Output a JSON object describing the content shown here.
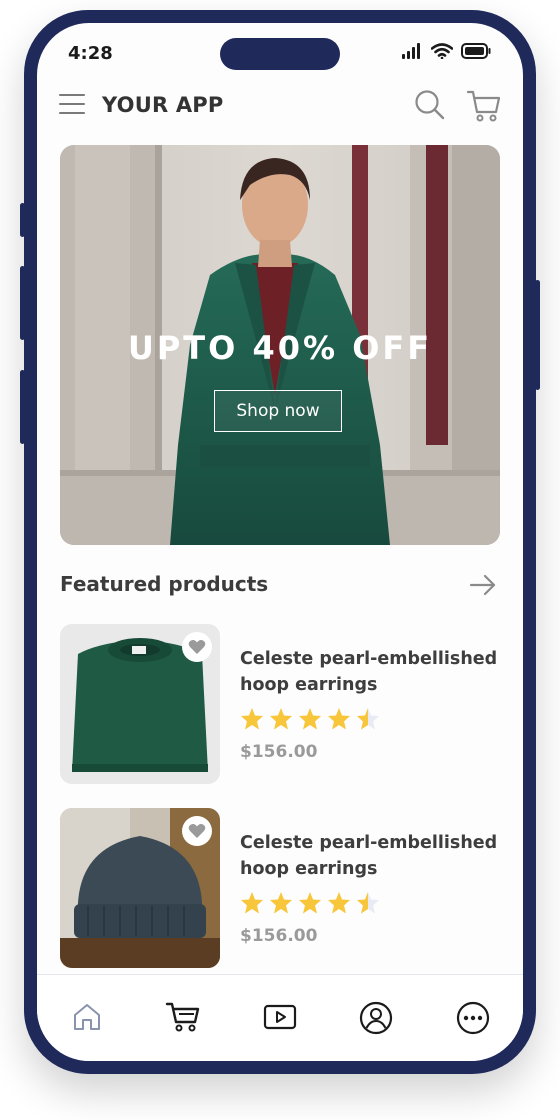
{
  "status_bar": {
    "time": "4:28"
  },
  "header": {
    "title": "YOUR APP"
  },
  "hero": {
    "headline": "UPTO 40% OFF",
    "cta_label": "Shop now"
  },
  "featured": {
    "title": "Featured products"
  },
  "products": [
    {
      "name": "Celeste pearl-embellished hoop earrings",
      "rating": 4.5,
      "price": "$156.00"
    },
    {
      "name": "Celeste pearl-embellished hoop earrings",
      "rating": 4.5,
      "price": "$156.00"
    }
  ],
  "tabs": [
    "home-icon",
    "cart-icon",
    "video-icon",
    "profile-icon",
    "more-icon"
  ],
  "colors": {
    "frame": "#1f2a5a",
    "star": "#f7c63a",
    "hero_coat": "#1f5a4a",
    "text": "#3e3e3e",
    "price": "#9a9a9a"
  }
}
